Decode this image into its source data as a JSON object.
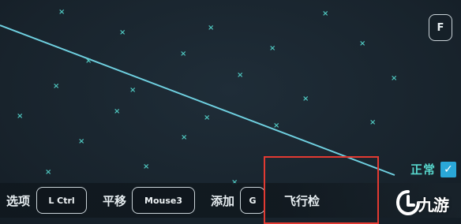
{
  "hud": {
    "top_right_key": "F",
    "status": {
      "label": "正常",
      "checkmark": "✓",
      "checked": true
    },
    "controls": [
      {
        "label": "选项",
        "key": "L Ctrl"
      },
      {
        "label": "平移",
        "key": "Mouse3"
      },
      {
        "label": "添加",
        "key": "G"
      },
      {
        "label": "飞行检"
      }
    ]
  },
  "map": {
    "marker_glyph": "×",
    "marker_count": 23,
    "route_color": "#6fd0e0",
    "marker_color": "#4fc6bf"
  },
  "highlight": {
    "color": "#e23a32"
  },
  "watermark": {
    "text": "九游",
    "logo_icon": "jiuyou-logo-icon"
  }
}
